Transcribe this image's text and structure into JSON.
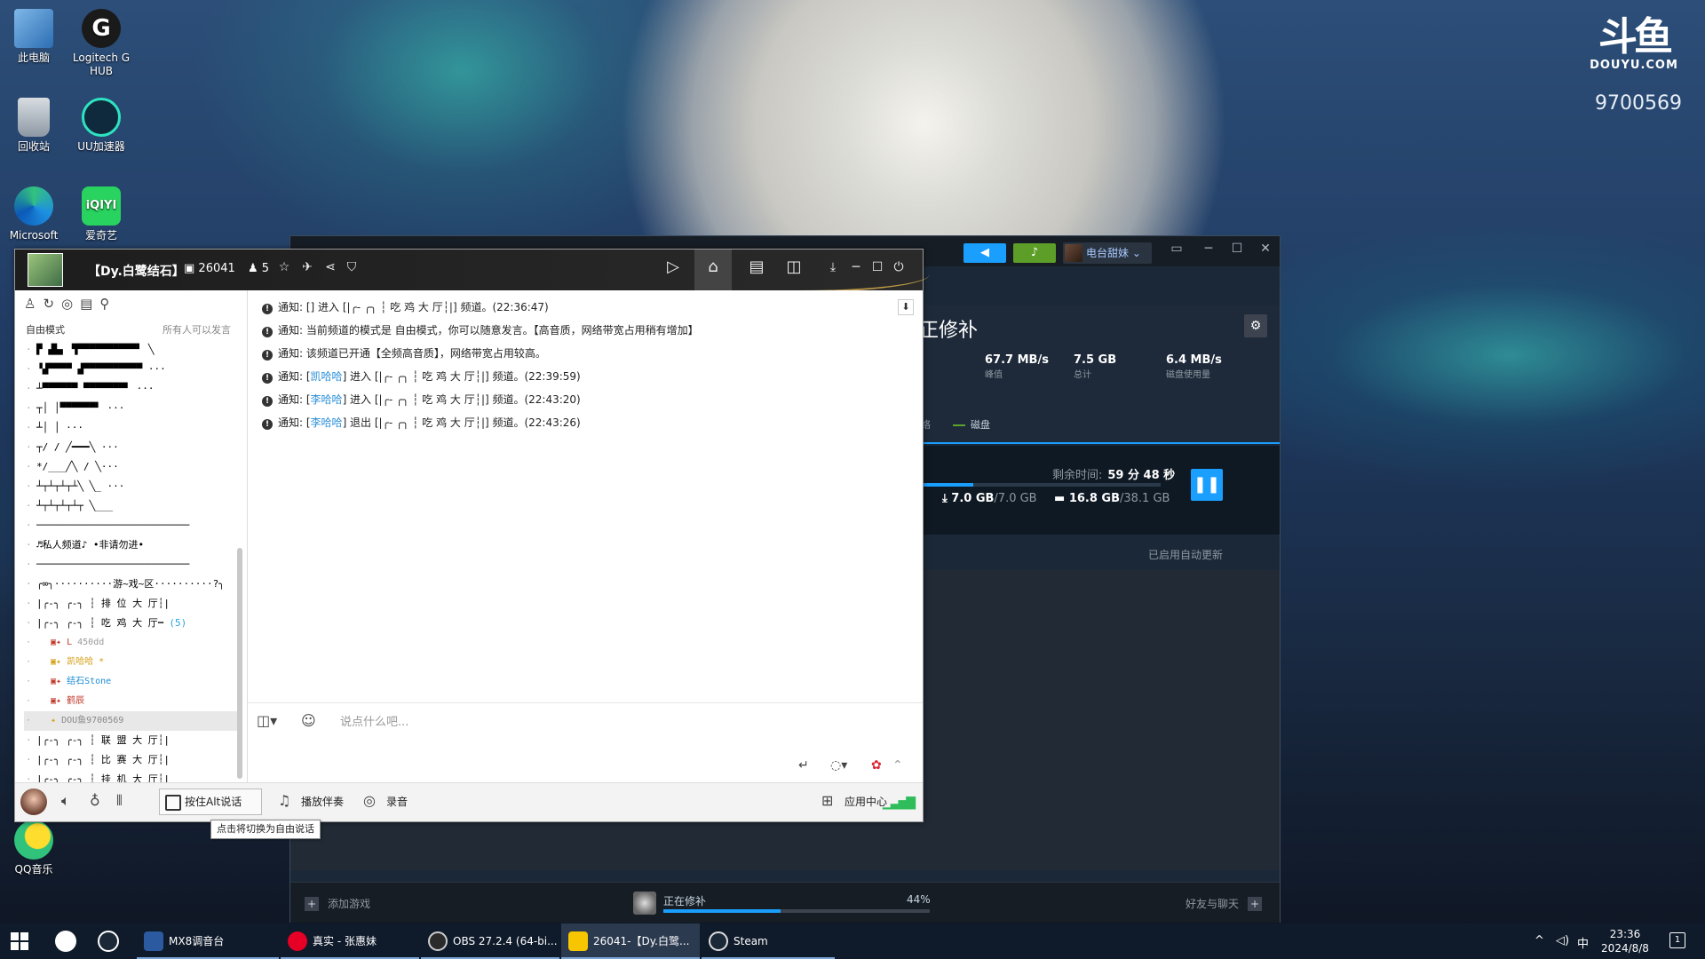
{
  "desktop": {
    "icons": [
      {
        "label": "此电脑",
        "icon": "computer-icon"
      },
      {
        "label": "Logitech G HUB",
        "icon": "logitech-icon"
      },
      {
        "label": "回收站",
        "icon": "recycle-bin-icon"
      },
      {
        "label": "UU加速器",
        "icon": "uu-accelerator-icon"
      },
      {
        "label": "Microsoft",
        "icon": "edge-icon"
      },
      {
        "label": "爱奇艺",
        "icon": "iqiyi-icon"
      },
      {
        "label": "QQ音乐",
        "icon": "qq-music-icon"
      }
    ],
    "logo_glyph": "iQIYI",
    "logitech_glyph": "G"
  },
  "watermark": {
    "brand": "斗鱼",
    "site": "DOUYU.COM",
    "room_id": "9700569"
  },
  "steam": {
    "user": "电台甜妹",
    "game_title": "正修补",
    "stats": [
      {
        "value": "67.7 MB/s",
        "label": "峰值"
      },
      {
        "value": "7.5 GB",
        "label": "总计"
      },
      {
        "value": "6.4 MB/s",
        "label": "磁盘使用量"
      }
    ],
    "legend_disk": "磁盘",
    "legend_prefix": "络",
    "remaining_label": "剩余时间:",
    "remaining_value": "59 分 48 秒",
    "download_done": "7.0 GB",
    "download_total": "/7.0 GB",
    "disk_done": "16.8 GB",
    "disk_total": "/38.1 GB",
    "download_progress": 0.22,
    "auto_update": "已启用自动更新",
    "footer": {
      "add_game": "添加游戏",
      "status": "正在修补",
      "percent": "44%",
      "progress": 0.44,
      "friends": "好友与聊天"
    },
    "colors": {
      "accent": "#1a9fff",
      "bg": "#1b2838"
    }
  },
  "yy": {
    "channel_name": "【Dy.白鹭结石】",
    "channel_id": "26041",
    "users_online": "5",
    "mode": "自由模式",
    "mode_right": "所有人可以发言",
    "channel_tree": [
      {
        "text": "▛  ▟▙▖  ▜▀▀▀▀▀▀▀▀▀▀▘  ╲",
        "type": "art"
      },
      {
        "text": "▝▟▀▀▀▀  ▟▀▀▀▀▀▀▀▀▀▀  ···",
        "type": "art"
      },
      {
        "text": "┴▀▀▀▀▀▀  ▀▀▀▀▀▀▀▘   ···",
        "type": "art"
      },
      {
        "text": "┬│        │▀▀▀▀▀▀▘   ···",
        "type": "art"
      },
      {
        "text": "┴│        │           ···",
        "type": "art"
      },
      {
        "text": "┬/      /      ╱━━━╲  ···",
        "type": "art"
      },
      {
        "text": "*/___╱╲       /     ╲···",
        "type": "art"
      },
      {
        "text": "┴┬┴┬┴┬┴╲     ╲_      ···",
        "type": "art"
      },
      {
        "text": " ┴┬┴┬┴┬┴┬ ╲___",
        "type": "art"
      },
      {
        "text": "──────────────────────────",
        "type": "art"
      },
      {
        "text": "♬私人频道♪ •非请勿进•",
        "type": "channel"
      },
      {
        "text": "──────────────────────────",
        "type": "art"
      },
      {
        "text": "╭∞╮··········游~戏~区··········?╮",
        "type": "channel"
      },
      {
        "text": "|╭-╮ ╭-╮ ┆  排 位 大 厅┆|",
        "type": "channel"
      },
      {
        "text": "|╭-╮ ╭-╮ ┆  吃 鸡 大 厅┅",
        "type": "channel",
        "count": "(5)"
      }
    ],
    "members": [
      {
        "name": "L",
        "extra": "450dd",
        "style": "red"
      },
      {
        "name": "凯哈哈 *",
        "extra": "",
        "style": "gold"
      },
      {
        "name": "结石Stone",
        "extra": "",
        "style": "blue"
      },
      {
        "name": "鹤辰",
        "extra": "",
        "style": "red"
      },
      {
        "name": "DOU鱼9700569",
        "extra": "",
        "style": "self"
      }
    ],
    "channel_tree_tail": [
      "|╭-╮ ╭-╮ ┆  联 盟 大 厅┆|",
      "|╭-╮ ╭-╮ ┆  比 赛 大 厅┆|",
      "|╭-╮ ╭-╮ ┆  挂 机 大 厅┆|"
    ],
    "messages": [
      {
        "prefix": "通知: [",
        "who": "",
        "body": "] 进入 [|╭-  ╭╮ ┆ 吃 鸡 大 厅┆|] 频道。(22:36:47)"
      },
      {
        "prefix": "通知: ",
        "who": "",
        "body": "当前频道的模式是 自由模式，你可以随意发言。【高音质，网络带宽占用稍有增加】"
      },
      {
        "prefix": "通知: ",
        "who": "",
        "body": "该频道已开通【全频高音质】，网络带宽占用较高。"
      },
      {
        "prefix": "通知: [",
        "who": "凯哈哈",
        "body": "] 进入 [|╭-  ╭╮ ┆ 吃 鸡 大 厅┆|] 频道。(22:39:59)"
      },
      {
        "prefix": "通知: [",
        "who": "李哈哈",
        "body": "] 进入 [|╭-  ╭╮ ┆ 吃 鸡 大 厅┆|] 频道。(22:43:20)"
      },
      {
        "prefix": "通知: [",
        "who": "李哈哈",
        "body": "] 退出 [|╭-  ╭╮ ┆ 吃 鸡 大 厅┆|] 频道。(22:43:26)"
      }
    ],
    "input_placeholder": "说点什么吧...",
    "bottom": {
      "push_to_talk": "按住Alt说话",
      "accompaniment": "播放伴奏",
      "record": "录音",
      "app_center": "应用中心"
    },
    "tooltip": "点击将切换为自由说话"
  },
  "taskbar": {
    "apps": [
      {
        "label": "MX8调音台",
        "icon": "mixer-icon",
        "color": "#2c5aa0"
      },
      {
        "label": "真实 - 张惠妹",
        "icon": "netease-music-icon",
        "color": "#e60026"
      },
      {
        "label": "OBS 27.2.4 (64-bi...",
        "icon": "obs-icon",
        "color": "#2b2b2b"
      },
      {
        "label": "26041-【Dy.白鹭...",
        "icon": "yy-icon",
        "color": "#f7c600"
      },
      {
        "label": "Steam",
        "icon": "steam-icon",
        "color": "#1b2838"
      }
    ],
    "ime": "中",
    "time": "23:36",
    "date": "2024/8/8",
    "notifications": "1"
  }
}
